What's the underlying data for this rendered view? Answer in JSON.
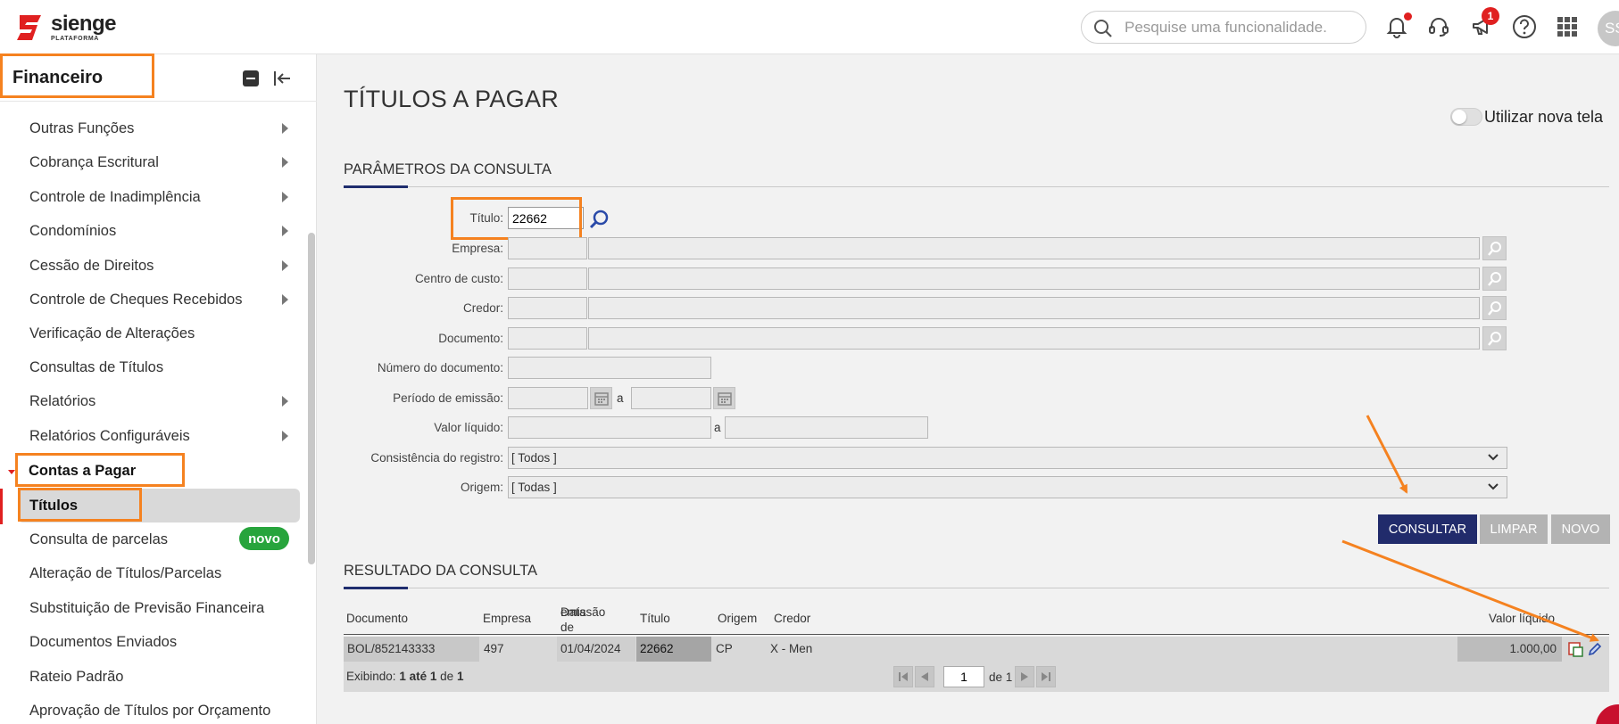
{
  "app": {
    "logo_name": "sienge",
    "logo_sub": "PLATAFORMA",
    "search_placeholder": "Pesquise uma funcionalidade.",
    "notification_badge": "1",
    "avatar_initials": "SS",
    "brand_color": "#e02020"
  },
  "sidebar": {
    "title": "Financeiro",
    "items": [
      {
        "label": "Outras Funções",
        "submenu": true
      },
      {
        "label": "Cobrança Escritural",
        "submenu": true
      },
      {
        "label": "Controle de Inadimplência",
        "submenu": true
      },
      {
        "label": "Condomínios",
        "submenu": true
      },
      {
        "label": "Cessão de Direitos",
        "submenu": true
      },
      {
        "label": "Controle de Cheques Recebidos",
        "submenu": true
      },
      {
        "label": "Verificação de Alterações",
        "submenu": false
      },
      {
        "label": "Consultas de Títulos",
        "submenu": false
      },
      {
        "label": "Relatórios",
        "submenu": true
      },
      {
        "label": "Relatórios Configuráveis",
        "submenu": true
      }
    ],
    "section": "Contas a Pagar",
    "sub_items": [
      {
        "label": "Títulos",
        "active": true
      },
      {
        "label": "Consulta de parcelas",
        "badge": "novo"
      },
      {
        "label": "Alteração de Títulos/Parcelas"
      },
      {
        "label": "Substituição de Previsão Financeira"
      },
      {
        "label": "Documentos Enviados"
      },
      {
        "label": "Rateio Padrão"
      },
      {
        "label": "Aprovação de Títulos por Orçamento"
      }
    ]
  },
  "main": {
    "page_title": "TÍTULOS A PAGAR",
    "toggle_label": "Utilizar nova tela",
    "params_title": "PARÂMETROS DA CONSULTA",
    "fields": {
      "titulo_label": "Título:",
      "titulo_value": "22662",
      "empresa_label": "Empresa:",
      "centro_label": "Centro de custo:",
      "credor_label": "Credor:",
      "documento_label": "Documento:",
      "numero_label": "Número do documento:",
      "periodo_label": "Período de emissão:",
      "valor_label": "Valor líquido:",
      "consistencia_label": "Consistência do registro:",
      "consistencia_value": "[ Todos ]",
      "origem_label": "Origem:",
      "origem_value": "[ Todas ]",
      "range_sep": "a"
    },
    "buttons": {
      "consultar": "CONSULTAR",
      "limpar": "LIMPAR",
      "novo": "NOVO"
    },
    "results_title": "RESULTADO DA CONSULTA",
    "table": {
      "headers": {
        "documento": "Documento",
        "empresa": "Empresa",
        "data_line1": "Data de",
        "data_line2": "emissão",
        "titulo": "Título",
        "origem": "Origem",
        "credor": "Credor",
        "valor": "Valor líquido"
      },
      "row": {
        "documento": "BOL/852143333",
        "empresa": "497",
        "data": "01/04/2024",
        "titulo": "22662",
        "origem": "CP",
        "credor": "X - Men",
        "valor": "1.000,00"
      }
    },
    "footer": {
      "prefix": "Exibindo:",
      "from": "1",
      "ate": "até",
      "to": "1",
      "de": "de",
      "total": "1",
      "page": "1",
      "page_of": "de 1"
    }
  }
}
